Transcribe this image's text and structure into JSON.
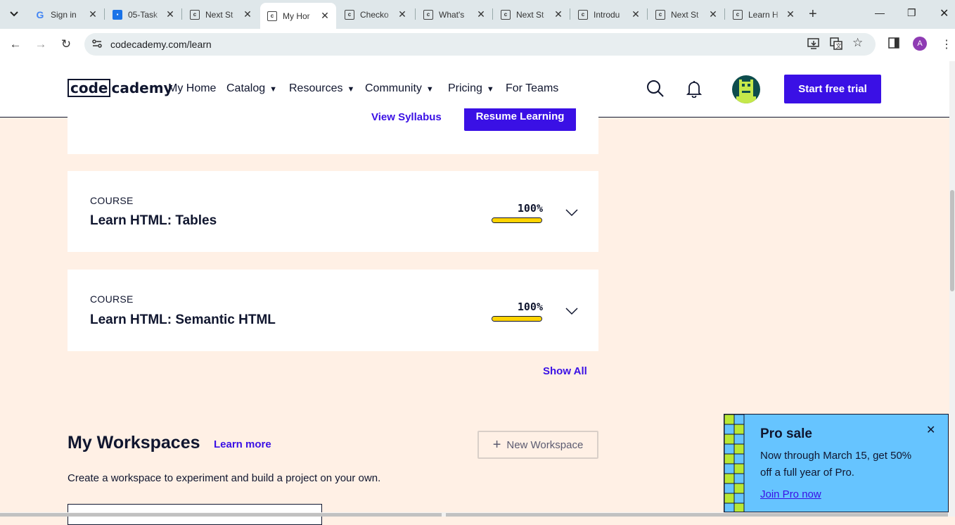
{
  "browser": {
    "tabs": [
      {
        "title": "Sign in",
        "favicon": "google-icon"
      },
      {
        "title": "05-Task",
        "favicon": "classroom-icon"
      },
      {
        "title": "Next St",
        "favicon": "codecademy-icon"
      },
      {
        "title": "My Hor",
        "favicon": "codecademy-icon"
      },
      {
        "title": "Checko",
        "favicon": "codecademy-icon"
      },
      {
        "title": "What's",
        "favicon": "codecademy-icon"
      },
      {
        "title": "Next St",
        "favicon": "codecademy-icon"
      },
      {
        "title": "Introdu",
        "favicon": "codecademy-icon"
      },
      {
        "title": "Next St",
        "favicon": "codecademy-icon"
      },
      {
        "title": "Learn H",
        "favicon": "codecademy-icon"
      }
    ],
    "active_tab": 3,
    "url": "codecademy.com/learn",
    "profile_initial": "A"
  },
  "header": {
    "logo_box": "code",
    "logo_rest": "cademy",
    "nav": {
      "home": "My Home",
      "catalog": "Catalog",
      "resources": "Resources",
      "community": "Community",
      "pricing": "Pricing",
      "teams": "For Teams"
    },
    "trial_button": "Start free trial"
  },
  "top_card": {
    "syllabus_link": "View Syllabus",
    "resume_button": "Resume Learning"
  },
  "courses": [
    {
      "kicker": "COURSE",
      "title": "Learn HTML: Tables",
      "progress_label": "100%",
      "progress": 1.0
    },
    {
      "kicker": "COURSE",
      "title": "Learn HTML: Semantic HTML",
      "progress_label": "100%",
      "progress": 1.0
    }
  ],
  "show_all": "Show All",
  "workspaces": {
    "title": "My Workspaces",
    "learn_more": "Learn more",
    "new_button": "New Workspace",
    "description": "Create a workspace to experiment and build a project on your own."
  },
  "promo": {
    "title": "Pro sale",
    "body": "Now through March 15, get 50% off a full year of Pro.",
    "link": "Join Pro now"
  },
  "colors": {
    "accent": "#3a10e5",
    "page_bg": "#fff0e5",
    "progress": "#ffd300",
    "promo_bg": "#66c4ff",
    "promo_pattern": "#b8e835"
  }
}
